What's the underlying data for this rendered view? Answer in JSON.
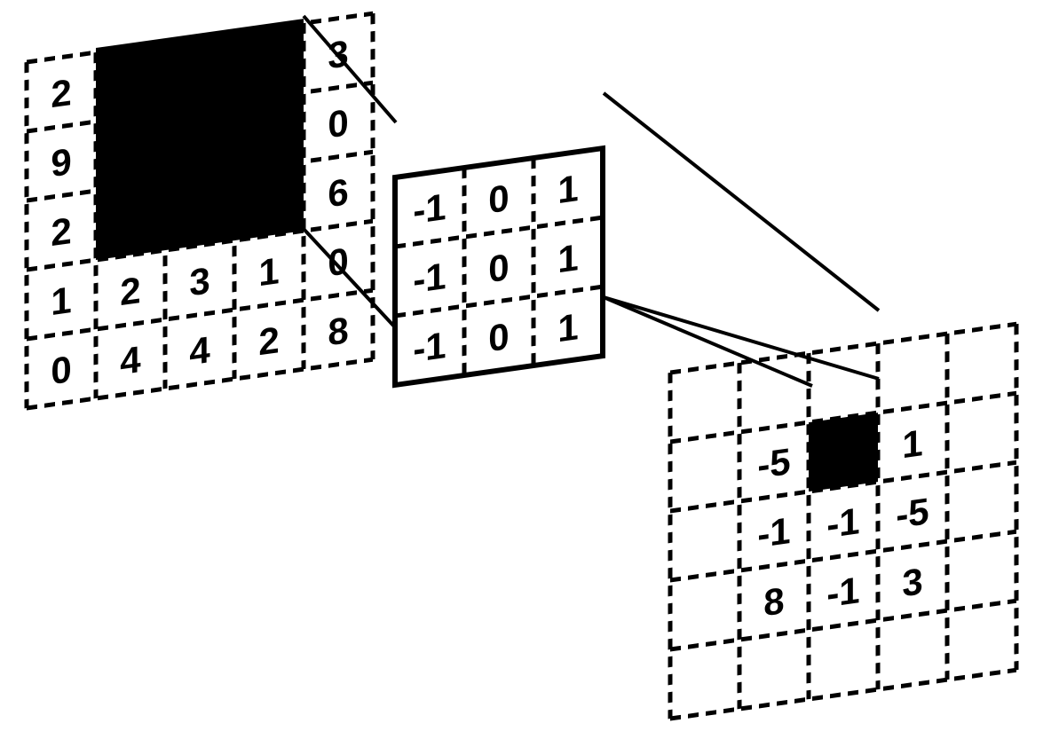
{
  "diagram_type": "convolution-operation",
  "input_matrix": {
    "rows": 5,
    "cols": 5,
    "highlighted_region": {
      "row_start": 0,
      "row_end": 2,
      "col_start": 1,
      "col_end": 3
    },
    "cells": {
      "r0c0": "2",
      "r0c4": "3",
      "r1c0": "9",
      "r1c4": "0",
      "r2c0": "2",
      "r2c4": "6",
      "r3c0": "1",
      "r3c1": "2",
      "r3c2": "3",
      "r3c3": "1",
      "r3c4": "0",
      "r4c0": "0",
      "r4c1": "4",
      "r4c2": "4",
      "r4c3": "2",
      "r4c4": "8"
    }
  },
  "kernel_matrix": {
    "rows": 3,
    "cols": 3,
    "cells": {
      "r0c0": "-1",
      "r0c1": "0",
      "r0c2": "1",
      "r1c0": "-1",
      "r1c1": "0",
      "r1c2": "1",
      "r2c0": "-1",
      "r2c1": "0",
      "r2c2": "1"
    }
  },
  "output_matrix": {
    "rows": 5,
    "cols": 5,
    "highlighted_cell": {
      "row": 1,
      "col": 2
    },
    "cells": {
      "r1c1": "-5",
      "r1c3": "1",
      "r2c1": "-1",
      "r2c2": "-1",
      "r2c3": "-5",
      "r3c1": "8",
      "r3c2": "-1",
      "r3c3": "3"
    }
  },
  "chart_data": {
    "type": "table",
    "description": "Convolution operation diagram with input, kernel, and output",
    "input": [
      [
        2,
        null,
        null,
        null,
        3
      ],
      [
        9,
        null,
        null,
        null,
        0
      ],
      [
        2,
        null,
        null,
        null,
        6
      ],
      [
        1,
        2,
        3,
        1,
        0
      ],
      [
        0,
        4,
        4,
        2,
        8
      ]
    ],
    "kernel": [
      [
        -1,
        0,
        1
      ],
      [
        -1,
        0,
        1
      ],
      [
        -1,
        0,
        1
      ]
    ],
    "output": [
      [
        null,
        null,
        null,
        null,
        null
      ],
      [
        null,
        -5,
        null,
        1,
        null
      ],
      [
        null,
        -1,
        -1,
        -5,
        null
      ],
      [
        null,
        8,
        -1,
        3,
        null
      ],
      [
        null,
        null,
        null,
        null,
        null
      ]
    ]
  }
}
